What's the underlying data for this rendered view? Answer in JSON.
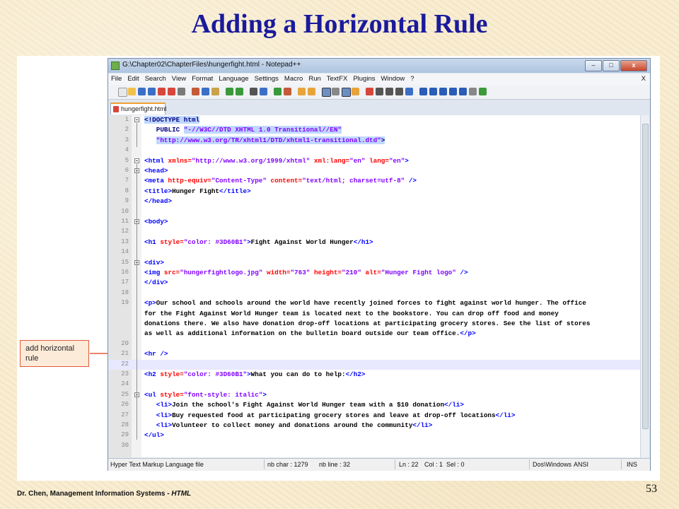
{
  "slide": {
    "title": "Adding a Horizontal Rule",
    "footer_text": "Dr. Chen, Management Information Systems - ",
    "footer_italic": "HTML",
    "page_number": "53"
  },
  "callout": {
    "text": "add horizontal rule",
    "border_color": "#e05a3c"
  },
  "window": {
    "title": "G:\\Chapter02\\ChapterFiles\\hungerfight.html - Notepad++",
    "buttons": [
      "–",
      "□",
      "x"
    ]
  },
  "menu": [
    "File",
    "Edit",
    "Search",
    "View",
    "Format",
    "Language",
    "Settings",
    "Macro",
    "Run",
    "TextFX",
    "Plugins",
    "Window",
    "?"
  ],
  "menu_close": "X",
  "tab": {
    "label": "hungerfight.html"
  },
  "editor": {
    "current_line": 22,
    "lines": [
      {
        "n": "1"
      },
      {
        "n": "2"
      },
      {
        "n": "3"
      },
      {
        "n": "4"
      },
      {
        "n": "5"
      },
      {
        "n": "6"
      },
      {
        "n": "7"
      },
      {
        "n": "8"
      },
      {
        "n": "9"
      },
      {
        "n": "10"
      },
      {
        "n": "11"
      },
      {
        "n": "12"
      },
      {
        "n": "13"
      },
      {
        "n": "14"
      },
      {
        "n": "15"
      },
      {
        "n": "16"
      },
      {
        "n": "17"
      },
      {
        "n": "18"
      },
      {
        "n": "19"
      },
      {
        "n": "20"
      },
      {
        "n": "21"
      },
      {
        "n": "22"
      },
      {
        "n": "23"
      },
      {
        "n": "24"
      },
      {
        "n": "25"
      },
      {
        "n": "26"
      },
      {
        "n": "27"
      },
      {
        "n": "28"
      },
      {
        "n": "29"
      },
      {
        "n": "30"
      }
    ],
    "text": {
      "doctype": "<!DOCTYPE html",
      "public_kw": "PUBLIC ",
      "public_id": "\"-//W3C//DTD XHTML 1.0 Transitional//EN\"",
      "dtd_url": "\"http://www.w3.org/TR/xhtml1/DTD/xhtml1-transitional.dtd\"",
      "html_open": "<html",
      "xmlns_attr": " xmlns=",
      "xmlns_val": "\"http://www.w3.org/1999/xhtml\"",
      "xmllang_attr": " xml:lang=",
      "en_val": "\"en\"",
      "lang_attr": " lang=",
      "head_open": "<head>",
      "meta_open": "<meta",
      "httpequiv_attr": " http-equiv=",
      "httpequiv_val": "\"Content-Type\"",
      "content_attr": " content=",
      "content_val": "\"text/html; charset=utf-8\"",
      "selfclose": " />",
      "title_open": "<title>",
      "title_text": "Hunger Fight",
      "title_close": "</title>",
      "head_close": "</head>",
      "body_open": "<body>",
      "h1_open": "<h1",
      "style_attr": " style=",
      "color_val": "\"color: #3D60B1\"",
      "h1_text": "Fight Against World Hunger",
      "h1_close": "</h1>",
      "div_open": "<div>",
      "img_open": "<img",
      "src_attr": " src=",
      "src_val": "\"hungerfightlogo.jpg\"",
      "width_attr": " width=",
      "width_val": "\"763\"",
      "height_attr": " height=",
      "height_val": "\"210\"",
      "alt_attr": " alt=",
      "alt_val": "\"Hunger Fight logo\"",
      "div_close": "</div>",
      "p_open": "<p>",
      "p_text1": "Our school and schools around the world have recently joined forces to fight against world hunger. The office",
      "p_text2": "for the Fight Against World Hunger team is located next to the bookstore. You can drop off food and money",
      "p_text3": "donations there. We also have donation drop-off locations at participating grocery stores. See the list of stores",
      "p_text4": "as well as additional information on the bulletin board outside our team office.",
      "p_close": "</p>",
      "hr": "<hr />",
      "h2_open": "<h2",
      "h2_text": "What you can do to help:",
      "h2_close": "</h2>",
      "ul_open": "<ul",
      "italic_val": "\"font-style: italic\"",
      "gt": ">",
      "li_open": "<li>",
      "li1": "Join the school's Fight Against World Hunger team with a $10 donation",
      "li2": "Buy requested food at participating grocery stores and leave at drop-off locations",
      "li3": "Volunteer to collect money and donations around the community",
      "li_close": "</li>",
      "ul_close": "</ul>"
    }
  },
  "status": {
    "filetype": "Hyper Text Markup Language file",
    "nbchar": "nb char : 1279",
    "nbline": "nb line : 32",
    "ln": "Ln : 22",
    "col": "Col : 1",
    "sel": "Sel : 0",
    "eol": "Dos\\Windows",
    "enc": "ANSI",
    "mode": "INS"
  }
}
